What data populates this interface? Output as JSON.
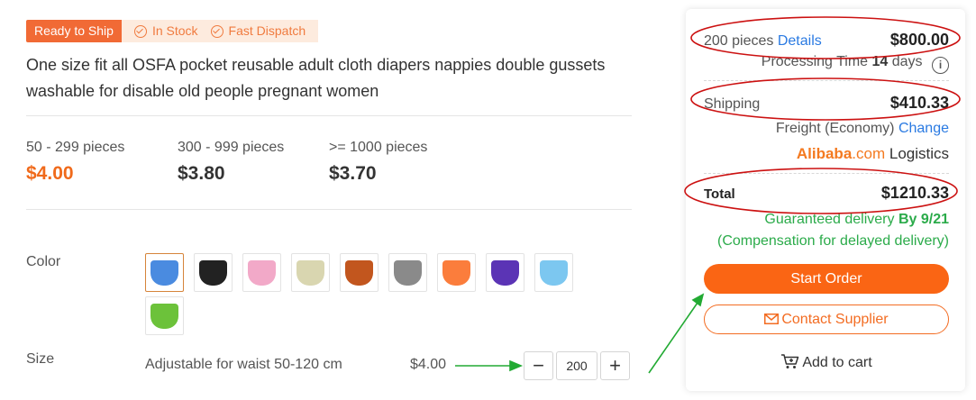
{
  "badges": {
    "ready": "Ready to Ship",
    "in_stock": "In Stock",
    "fast_dispatch": "Fast Dispatch"
  },
  "product": {
    "title": "One size fit all OSFA pocket reusable adult cloth diapers nappies double gussets washable for disable old people pregnant women"
  },
  "price_tiers": [
    {
      "range": "50 - 299 pieces",
      "price": "$4.00",
      "highlight": true
    },
    {
      "range": "300 - 999 pieces",
      "price": "$3.80",
      "highlight": false
    },
    {
      "range": ">= 1000 pieces",
      "price": "$3.70",
      "highlight": false
    }
  ],
  "color": {
    "label": "Color",
    "swatches": [
      "#4a8be0",
      "#222222",
      "#f2a9c8",
      "#d9d6b0",
      "#c2561e",
      "#8a8a8a",
      "#fb7d3c",
      "#5b34b5",
      "#7cc7f0",
      "#6cc23a"
    ],
    "selected_index": 0
  },
  "size": {
    "label": "Size",
    "description": "Adjustable for waist 50-120 cm",
    "price": "$4.00",
    "quantity": "200",
    "minus": "−",
    "plus": "+"
  },
  "summary": {
    "pieces": "200 pieces",
    "details_link": "Details",
    "subtotal": "$800.00",
    "processing_prefix": "Processing Time",
    "processing_days": "14",
    "processing_suffix": "days",
    "info_icon": "i",
    "shipping_label": "Shipping",
    "shipping_cost": "$410.33",
    "freight": "Freight (Economy)",
    "change_link": "Change",
    "logistics_brand": "Alibaba",
    "logistics_domain": ".com",
    "logistics_label": "Logistics",
    "total_label": "Total",
    "total": "$1210.33",
    "guaranteed_prefix": "Guaranteed delivery",
    "guaranteed_date": "By 9/21",
    "compensation": "(Compensation for delayed delivery)",
    "start_order": "Start Order",
    "contact_supplier": "Contact Supplier",
    "add_to_cart": "Add to cart"
  },
  "colors": {
    "accent_orange": "#fa6514",
    "link_blue": "#2a7ae2",
    "guarantee_green": "#2bab4a",
    "annotation_red": "#cc1111",
    "annotation_green": "#22aa33"
  }
}
